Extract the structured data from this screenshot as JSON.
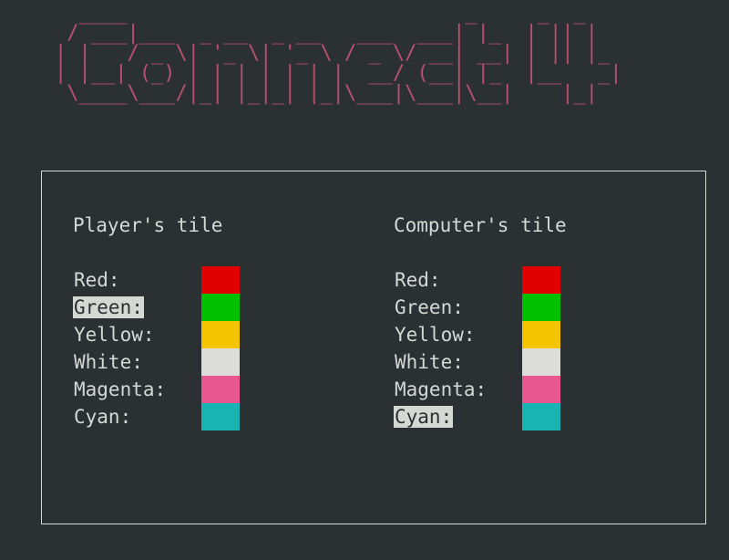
{
  "banner": {
    "title": "Connect 4",
    "ascii": "  ____                            _     _  _\n / ___|___  _ __  _ __   ___  ___| |_  | || |\n| |   / _ \\| '_ \\| '_ \\ / _ \\/ __| __| | || |_\n| |__| (_) | | | | | | |  __/ (__| |_  |__   _|\n \\____\\___/|_| |_|_| |_|\\___|\\___|\\__|    |_|"
  },
  "player": {
    "title": "Player's tile",
    "selected_index": 1,
    "tiles": [
      {
        "label": "Red:",
        "color": "#e00000"
      },
      {
        "label": "Green:",
        "color": "#00c000"
      },
      {
        "label": "Yellow:",
        "color": "#f4c400"
      },
      {
        "label": "White:",
        "color": "#dcdcd8"
      },
      {
        "label": "Magenta:",
        "color": "#e8578f"
      },
      {
        "label": "Cyan:",
        "color": "#1ab3b3"
      }
    ]
  },
  "computer": {
    "title": "Computer's tile",
    "selected_index": 5,
    "tiles": [
      {
        "label": "Red:",
        "color": "#e00000"
      },
      {
        "label": "Green:",
        "color": "#00c000"
      },
      {
        "label": "Yellow:",
        "color": "#f4c400"
      },
      {
        "label": "White:",
        "color": "#dcdcd8"
      },
      {
        "label": "Magenta:",
        "color": "#e8578f"
      },
      {
        "label": "Cyan:",
        "color": "#1ab3b3"
      }
    ]
  },
  "colors": {
    "background": "#2b3033",
    "foreground": "#d6d8d4",
    "banner": "#b8506e"
  }
}
